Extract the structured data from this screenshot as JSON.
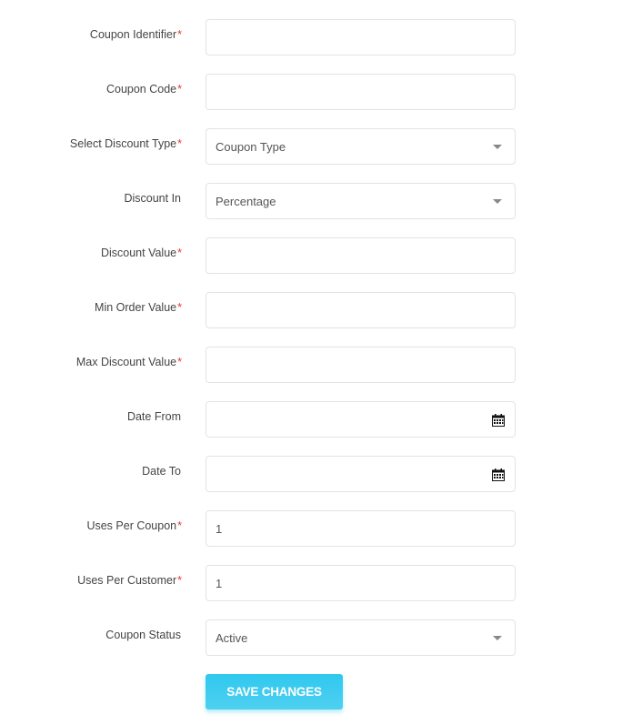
{
  "fields": [
    {
      "label": "Coupon Identifier",
      "required": "*",
      "type": "text",
      "value": ""
    },
    {
      "label": "Coupon Code",
      "required": "*",
      "type": "text",
      "value": ""
    },
    {
      "label": "Select Discount Type",
      "required": "*",
      "type": "select",
      "value": "Coupon Type"
    },
    {
      "label": "Discount In",
      "required": "",
      "type": "select",
      "value": "Percentage"
    },
    {
      "label": "Discount Value",
      "required": "*",
      "type": "text",
      "value": ""
    },
    {
      "label": "Min Order Value",
      "required": "*",
      "type": "text",
      "value": ""
    },
    {
      "label": "Max Discount Value",
      "required": "*",
      "type": "text",
      "value": ""
    },
    {
      "label": "Date From",
      "required": "",
      "type": "date",
      "value": "",
      "icon": "calendar-icon"
    },
    {
      "label": "Date To",
      "required": "",
      "type": "date",
      "value": "",
      "icon": "calendar-icon"
    },
    {
      "label": "Uses Per Coupon",
      "required": "*",
      "type": "text",
      "value": "1"
    },
    {
      "label": "Uses Per Customer",
      "required": "*",
      "type": "text",
      "value": "1"
    },
    {
      "label": "Coupon Status",
      "required": "",
      "type": "select",
      "value": "Active"
    }
  ],
  "save_button": {
    "label": "SAVE CHANGES"
  },
  "colors": {
    "accent": "#2fc8ef",
    "required": "#e53935"
  }
}
